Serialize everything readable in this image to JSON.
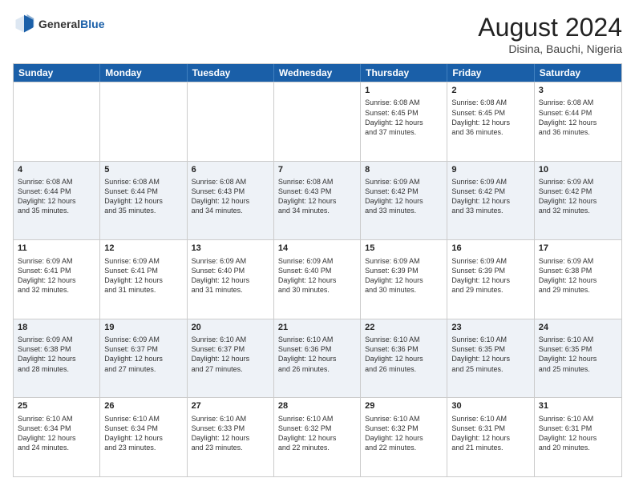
{
  "header": {
    "logo_general": "General",
    "logo_blue": "Blue",
    "month_title": "August 2024",
    "location": "Disina, Bauchi, Nigeria"
  },
  "days_of_week": [
    "Sunday",
    "Monday",
    "Tuesday",
    "Wednesday",
    "Thursday",
    "Friday",
    "Saturday"
  ],
  "rows": [
    [
      {
        "day": "",
        "text": ""
      },
      {
        "day": "",
        "text": ""
      },
      {
        "day": "",
        "text": ""
      },
      {
        "day": "",
        "text": ""
      },
      {
        "day": "1",
        "text": "Sunrise: 6:08 AM\nSunset: 6:45 PM\nDaylight: 12 hours\nand 37 minutes."
      },
      {
        "day": "2",
        "text": "Sunrise: 6:08 AM\nSunset: 6:45 PM\nDaylight: 12 hours\nand 36 minutes."
      },
      {
        "day": "3",
        "text": "Sunrise: 6:08 AM\nSunset: 6:44 PM\nDaylight: 12 hours\nand 36 minutes."
      }
    ],
    [
      {
        "day": "4",
        "text": "Sunrise: 6:08 AM\nSunset: 6:44 PM\nDaylight: 12 hours\nand 35 minutes."
      },
      {
        "day": "5",
        "text": "Sunrise: 6:08 AM\nSunset: 6:44 PM\nDaylight: 12 hours\nand 35 minutes."
      },
      {
        "day": "6",
        "text": "Sunrise: 6:08 AM\nSunset: 6:43 PM\nDaylight: 12 hours\nand 34 minutes."
      },
      {
        "day": "7",
        "text": "Sunrise: 6:08 AM\nSunset: 6:43 PM\nDaylight: 12 hours\nand 34 minutes."
      },
      {
        "day": "8",
        "text": "Sunrise: 6:09 AM\nSunset: 6:42 PM\nDaylight: 12 hours\nand 33 minutes."
      },
      {
        "day": "9",
        "text": "Sunrise: 6:09 AM\nSunset: 6:42 PM\nDaylight: 12 hours\nand 33 minutes."
      },
      {
        "day": "10",
        "text": "Sunrise: 6:09 AM\nSunset: 6:42 PM\nDaylight: 12 hours\nand 32 minutes."
      }
    ],
    [
      {
        "day": "11",
        "text": "Sunrise: 6:09 AM\nSunset: 6:41 PM\nDaylight: 12 hours\nand 32 minutes."
      },
      {
        "day": "12",
        "text": "Sunrise: 6:09 AM\nSunset: 6:41 PM\nDaylight: 12 hours\nand 31 minutes."
      },
      {
        "day": "13",
        "text": "Sunrise: 6:09 AM\nSunset: 6:40 PM\nDaylight: 12 hours\nand 31 minutes."
      },
      {
        "day": "14",
        "text": "Sunrise: 6:09 AM\nSunset: 6:40 PM\nDaylight: 12 hours\nand 30 minutes."
      },
      {
        "day": "15",
        "text": "Sunrise: 6:09 AM\nSunset: 6:39 PM\nDaylight: 12 hours\nand 30 minutes."
      },
      {
        "day": "16",
        "text": "Sunrise: 6:09 AM\nSunset: 6:39 PM\nDaylight: 12 hours\nand 29 minutes."
      },
      {
        "day": "17",
        "text": "Sunrise: 6:09 AM\nSunset: 6:38 PM\nDaylight: 12 hours\nand 29 minutes."
      }
    ],
    [
      {
        "day": "18",
        "text": "Sunrise: 6:09 AM\nSunset: 6:38 PM\nDaylight: 12 hours\nand 28 minutes."
      },
      {
        "day": "19",
        "text": "Sunrise: 6:09 AM\nSunset: 6:37 PM\nDaylight: 12 hours\nand 27 minutes."
      },
      {
        "day": "20",
        "text": "Sunrise: 6:10 AM\nSunset: 6:37 PM\nDaylight: 12 hours\nand 27 minutes."
      },
      {
        "day": "21",
        "text": "Sunrise: 6:10 AM\nSunset: 6:36 PM\nDaylight: 12 hours\nand 26 minutes."
      },
      {
        "day": "22",
        "text": "Sunrise: 6:10 AM\nSunset: 6:36 PM\nDaylight: 12 hours\nand 26 minutes."
      },
      {
        "day": "23",
        "text": "Sunrise: 6:10 AM\nSunset: 6:35 PM\nDaylight: 12 hours\nand 25 minutes."
      },
      {
        "day": "24",
        "text": "Sunrise: 6:10 AM\nSunset: 6:35 PM\nDaylight: 12 hours\nand 25 minutes."
      }
    ],
    [
      {
        "day": "25",
        "text": "Sunrise: 6:10 AM\nSunset: 6:34 PM\nDaylight: 12 hours\nand 24 minutes."
      },
      {
        "day": "26",
        "text": "Sunrise: 6:10 AM\nSunset: 6:34 PM\nDaylight: 12 hours\nand 23 minutes."
      },
      {
        "day": "27",
        "text": "Sunrise: 6:10 AM\nSunset: 6:33 PM\nDaylight: 12 hours\nand 23 minutes."
      },
      {
        "day": "28",
        "text": "Sunrise: 6:10 AM\nSunset: 6:32 PM\nDaylight: 12 hours\nand 22 minutes."
      },
      {
        "day": "29",
        "text": "Sunrise: 6:10 AM\nSunset: 6:32 PM\nDaylight: 12 hours\nand 22 minutes."
      },
      {
        "day": "30",
        "text": "Sunrise: 6:10 AM\nSunset: 6:31 PM\nDaylight: 12 hours\nand 21 minutes."
      },
      {
        "day": "31",
        "text": "Sunrise: 6:10 AM\nSunset: 6:31 PM\nDaylight: 12 hours\nand 20 minutes."
      }
    ]
  ]
}
